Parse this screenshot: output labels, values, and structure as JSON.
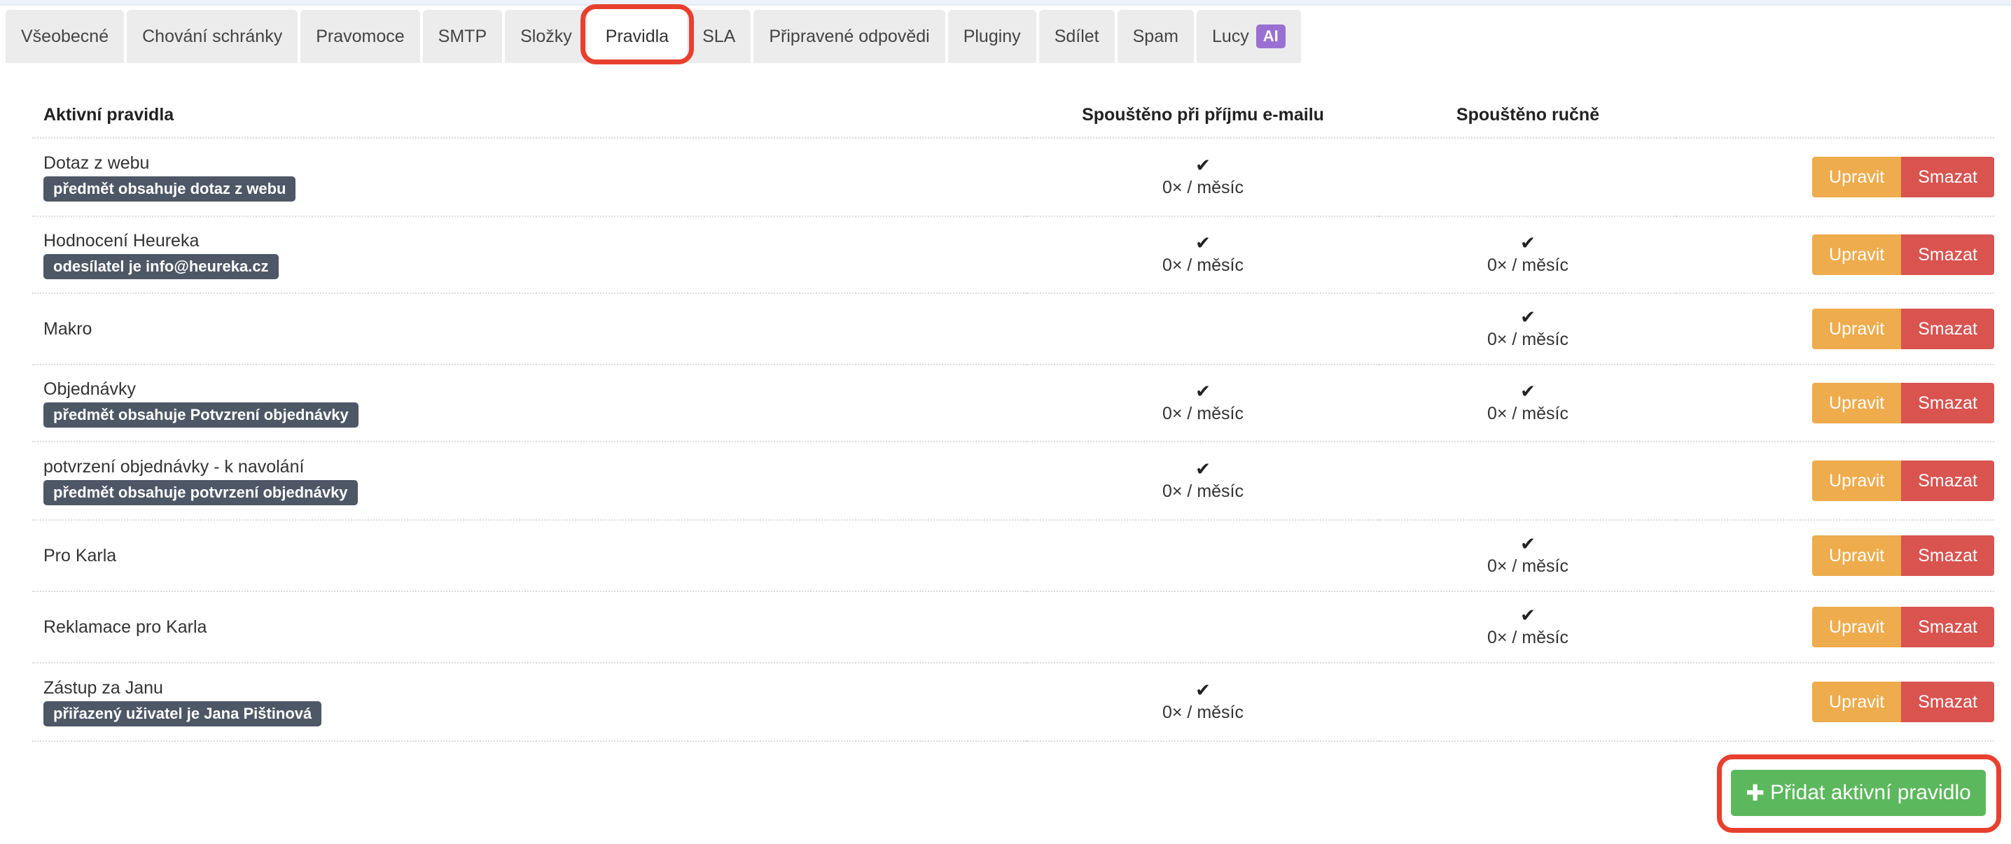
{
  "tabs": [
    {
      "label": "Všeobecné",
      "active": false
    },
    {
      "label": "Chování schránky",
      "active": false
    },
    {
      "label": "Pravomoce",
      "active": false
    },
    {
      "label": "SMTP",
      "active": false
    },
    {
      "label": "Složky",
      "active": false
    },
    {
      "label": "Pravidla",
      "active": true
    },
    {
      "label": "SLA",
      "active": false
    },
    {
      "label": "Připravené odpovědi",
      "active": false
    },
    {
      "label": "Pluginy",
      "active": false
    },
    {
      "label": "Sdílet",
      "active": false
    },
    {
      "label": "Spam",
      "active": false
    },
    {
      "label": "Lucy",
      "badge": "AI",
      "active": false
    }
  ],
  "table": {
    "headers": {
      "name": "Aktivní pravidla",
      "on_receive": "Spouštěno při příjmu e-mailu",
      "manual": "Spouštěno ručně"
    },
    "edit_label": "Upravit",
    "delete_label": "Smazat",
    "rows": [
      {
        "name": "Dotaz z webu",
        "condition": "předmět obsahuje dotaz z webu",
        "on_receive": "0× / měsíc",
        "manual": null
      },
      {
        "name": "Hodnocení Heureka",
        "condition": "odesílatel je info@heureka.cz",
        "on_receive": "0× / měsíc",
        "manual": "0× / měsíc"
      },
      {
        "name": "Makro",
        "condition": null,
        "on_receive": null,
        "manual": "0× / měsíc"
      },
      {
        "name": "Objednávky",
        "condition": "předmět obsahuje Potvzrení objednávky",
        "on_receive": "0× / měsíc",
        "manual": "0× / měsíc"
      },
      {
        "name": "potvrzení objednávky - k navolání",
        "condition": "předmět obsahuje potvrzení objednávky",
        "on_receive": "0× / měsíc",
        "manual": null
      },
      {
        "name": "Pro Karla",
        "condition": null,
        "on_receive": null,
        "manual": "0× / měsíc"
      },
      {
        "name": "Reklamace pro Karla",
        "condition": null,
        "on_receive": null,
        "manual": "0× / měsíc"
      },
      {
        "name": "Zástup za Janu",
        "condition": "přiřazený uživatel je Jana Pištinová",
        "on_receive": "0× / měsíc",
        "manual": null
      }
    ]
  },
  "add_button": {
    "label": "Přidat aktivní pravidlo",
    "icon": "plus-icon"
  },
  "colors": {
    "highlight": "#e8402f",
    "edit": "#eeac4d",
    "delete": "#d9534f",
    "add": "#5cb85c",
    "condition_badge": "#4e5766",
    "ai_badge": "#9a6fd2"
  }
}
